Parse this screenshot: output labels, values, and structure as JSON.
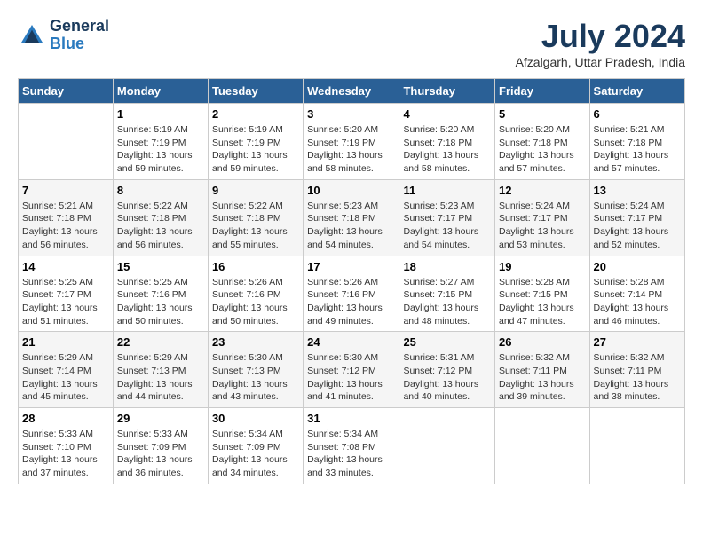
{
  "header": {
    "logo_line1": "General",
    "logo_line2": "Blue",
    "month_year": "July 2024",
    "location": "Afzalgarh, Uttar Pradesh, India"
  },
  "columns": [
    "Sunday",
    "Monday",
    "Tuesday",
    "Wednesday",
    "Thursday",
    "Friday",
    "Saturday"
  ],
  "weeks": [
    [
      {
        "day": "",
        "sunrise": "",
        "sunset": "",
        "daylight": ""
      },
      {
        "day": "1",
        "sunrise": "Sunrise: 5:19 AM",
        "sunset": "Sunset: 7:19 PM",
        "daylight": "Daylight: 13 hours and 59 minutes."
      },
      {
        "day": "2",
        "sunrise": "Sunrise: 5:19 AM",
        "sunset": "Sunset: 7:19 PM",
        "daylight": "Daylight: 13 hours and 59 minutes."
      },
      {
        "day": "3",
        "sunrise": "Sunrise: 5:20 AM",
        "sunset": "Sunset: 7:19 PM",
        "daylight": "Daylight: 13 hours and 58 minutes."
      },
      {
        "day": "4",
        "sunrise": "Sunrise: 5:20 AM",
        "sunset": "Sunset: 7:18 PM",
        "daylight": "Daylight: 13 hours and 58 minutes."
      },
      {
        "day": "5",
        "sunrise": "Sunrise: 5:20 AM",
        "sunset": "Sunset: 7:18 PM",
        "daylight": "Daylight: 13 hours and 57 minutes."
      },
      {
        "day": "6",
        "sunrise": "Sunrise: 5:21 AM",
        "sunset": "Sunset: 7:18 PM",
        "daylight": "Daylight: 13 hours and 57 minutes."
      }
    ],
    [
      {
        "day": "7",
        "sunrise": "Sunrise: 5:21 AM",
        "sunset": "Sunset: 7:18 PM",
        "daylight": "Daylight: 13 hours and 56 minutes."
      },
      {
        "day": "8",
        "sunrise": "Sunrise: 5:22 AM",
        "sunset": "Sunset: 7:18 PM",
        "daylight": "Daylight: 13 hours and 56 minutes."
      },
      {
        "day": "9",
        "sunrise": "Sunrise: 5:22 AM",
        "sunset": "Sunset: 7:18 PM",
        "daylight": "Daylight: 13 hours and 55 minutes."
      },
      {
        "day": "10",
        "sunrise": "Sunrise: 5:23 AM",
        "sunset": "Sunset: 7:18 PM",
        "daylight": "Daylight: 13 hours and 54 minutes."
      },
      {
        "day": "11",
        "sunrise": "Sunrise: 5:23 AM",
        "sunset": "Sunset: 7:17 PM",
        "daylight": "Daylight: 13 hours and 54 minutes."
      },
      {
        "day": "12",
        "sunrise": "Sunrise: 5:24 AM",
        "sunset": "Sunset: 7:17 PM",
        "daylight": "Daylight: 13 hours and 53 minutes."
      },
      {
        "day": "13",
        "sunrise": "Sunrise: 5:24 AM",
        "sunset": "Sunset: 7:17 PM",
        "daylight": "Daylight: 13 hours and 52 minutes."
      }
    ],
    [
      {
        "day": "14",
        "sunrise": "Sunrise: 5:25 AM",
        "sunset": "Sunset: 7:17 PM",
        "daylight": "Daylight: 13 hours and 51 minutes."
      },
      {
        "day": "15",
        "sunrise": "Sunrise: 5:25 AM",
        "sunset": "Sunset: 7:16 PM",
        "daylight": "Daylight: 13 hours and 50 minutes."
      },
      {
        "day": "16",
        "sunrise": "Sunrise: 5:26 AM",
        "sunset": "Sunset: 7:16 PM",
        "daylight": "Daylight: 13 hours and 50 minutes."
      },
      {
        "day": "17",
        "sunrise": "Sunrise: 5:26 AM",
        "sunset": "Sunset: 7:16 PM",
        "daylight": "Daylight: 13 hours and 49 minutes."
      },
      {
        "day": "18",
        "sunrise": "Sunrise: 5:27 AM",
        "sunset": "Sunset: 7:15 PM",
        "daylight": "Daylight: 13 hours and 48 minutes."
      },
      {
        "day": "19",
        "sunrise": "Sunrise: 5:28 AM",
        "sunset": "Sunset: 7:15 PM",
        "daylight": "Daylight: 13 hours and 47 minutes."
      },
      {
        "day": "20",
        "sunrise": "Sunrise: 5:28 AM",
        "sunset": "Sunset: 7:14 PM",
        "daylight": "Daylight: 13 hours and 46 minutes."
      }
    ],
    [
      {
        "day": "21",
        "sunrise": "Sunrise: 5:29 AM",
        "sunset": "Sunset: 7:14 PM",
        "daylight": "Daylight: 13 hours and 45 minutes."
      },
      {
        "day": "22",
        "sunrise": "Sunrise: 5:29 AM",
        "sunset": "Sunset: 7:13 PM",
        "daylight": "Daylight: 13 hours and 44 minutes."
      },
      {
        "day": "23",
        "sunrise": "Sunrise: 5:30 AM",
        "sunset": "Sunset: 7:13 PM",
        "daylight": "Daylight: 13 hours and 43 minutes."
      },
      {
        "day": "24",
        "sunrise": "Sunrise: 5:30 AM",
        "sunset": "Sunset: 7:12 PM",
        "daylight": "Daylight: 13 hours and 41 minutes."
      },
      {
        "day": "25",
        "sunrise": "Sunrise: 5:31 AM",
        "sunset": "Sunset: 7:12 PM",
        "daylight": "Daylight: 13 hours and 40 minutes."
      },
      {
        "day": "26",
        "sunrise": "Sunrise: 5:32 AM",
        "sunset": "Sunset: 7:11 PM",
        "daylight": "Daylight: 13 hours and 39 minutes."
      },
      {
        "day": "27",
        "sunrise": "Sunrise: 5:32 AM",
        "sunset": "Sunset: 7:11 PM",
        "daylight": "Daylight: 13 hours and 38 minutes."
      }
    ],
    [
      {
        "day": "28",
        "sunrise": "Sunrise: 5:33 AM",
        "sunset": "Sunset: 7:10 PM",
        "daylight": "Daylight: 13 hours and 37 minutes."
      },
      {
        "day": "29",
        "sunrise": "Sunrise: 5:33 AM",
        "sunset": "Sunset: 7:09 PM",
        "daylight": "Daylight: 13 hours and 36 minutes."
      },
      {
        "day": "30",
        "sunrise": "Sunrise: 5:34 AM",
        "sunset": "Sunset: 7:09 PM",
        "daylight": "Daylight: 13 hours and 34 minutes."
      },
      {
        "day": "31",
        "sunrise": "Sunrise: 5:34 AM",
        "sunset": "Sunset: 7:08 PM",
        "daylight": "Daylight: 13 hours and 33 minutes."
      },
      {
        "day": "",
        "sunrise": "",
        "sunset": "",
        "daylight": ""
      },
      {
        "day": "",
        "sunrise": "",
        "sunset": "",
        "daylight": ""
      },
      {
        "day": "",
        "sunrise": "",
        "sunset": "",
        "daylight": ""
      }
    ]
  ]
}
